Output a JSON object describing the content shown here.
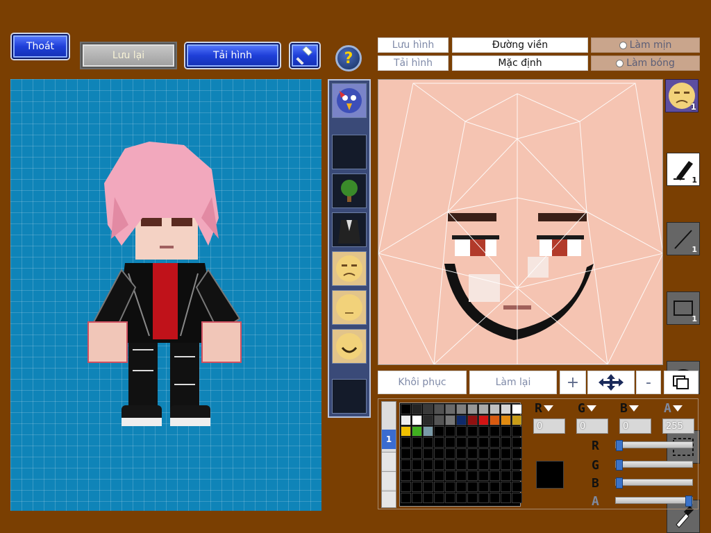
{
  "top_buttons": {
    "exit": "Thoát",
    "save": "Lưu lại",
    "load": "Tải hình",
    "help": "?"
  },
  "editor_toolbar": {
    "save_image": "Lưu hình",
    "load_image": "Tải hình",
    "outline": "Đường viền",
    "default": "Mặc định",
    "smooth": "Làm mịn",
    "glossy": "Làm bóng"
  },
  "face_slot_badge": "1",
  "tools": [
    {
      "name": "pen-tool",
      "count": "1"
    },
    {
      "name": "line-tool",
      "count": "1"
    },
    {
      "name": "rectangle-tool",
      "count": "1"
    },
    {
      "name": "ellipse-tool",
      "count": "1"
    },
    {
      "name": "select-tool",
      "count": ""
    },
    {
      "name": "eyedropper-tool",
      "count": ""
    }
  ],
  "bottom_bar": {
    "restore": "Khôi phục",
    "redo": "Làm lại",
    "zoom_in": "+",
    "zoom_out": "-"
  },
  "palette": {
    "tab_label": "1",
    "colors": [
      "#000000",
      "#242424",
      "#3a3a3a",
      "#525252",
      "#6a6a6a",
      "#808080",
      "#979797",
      "#aaaaaa",
      "#c0c0c0",
      "#d6d6d6",
      "#ffffff",
      "#eeeeee",
      "#ffffff",
      "#2a2a2a",
      "#555555",
      "#777777",
      "#0f2a6a",
      "#8f1010",
      "#d21414",
      "#d85a10",
      "#e08a10",
      "#c89c18",
      "#f0c000",
      "#40b020",
      "#7a9aa8"
    ],
    "current_color": "#000000"
  },
  "color_values": {
    "r_label": "R",
    "g_label": "G",
    "b_label": "B",
    "a_label": "A",
    "r": "0",
    "g": "0",
    "b": "0",
    "a": "255"
  },
  "sliders": {
    "r": 0,
    "g": 0,
    "b": 0,
    "a": 1
  }
}
